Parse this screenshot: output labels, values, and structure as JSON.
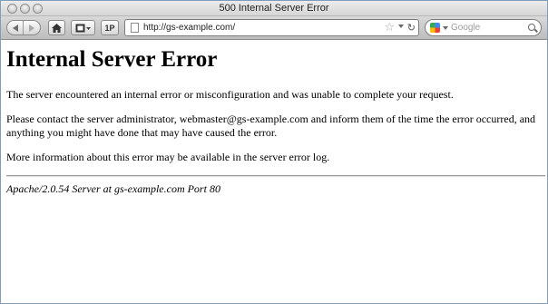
{
  "window": {
    "title": "500 Internal Server Error"
  },
  "toolbar": {
    "back_icon": "back-arrow-icon",
    "forward_icon": "forward-arrow-icon",
    "home_icon": "home-icon",
    "bookmarks_icon": "bookmarks-icon",
    "onepassword_label": "1P",
    "url": "http://gs-example.com/",
    "search_placeholder": "Google"
  },
  "page": {
    "heading": "Internal Server Error",
    "paragraph1": "The server encountered an internal error or misconfiguration and was unable to complete your request.",
    "paragraph2": "Please contact the server administrator, webmaster@gs-example.com and inform them of the time the error occurred, and anything you might have done that may have caused the error.",
    "paragraph3": "More information about this error may be available in the server error log.",
    "signature": "Apache/2.0.54 Server at gs-example.com Port 80"
  }
}
